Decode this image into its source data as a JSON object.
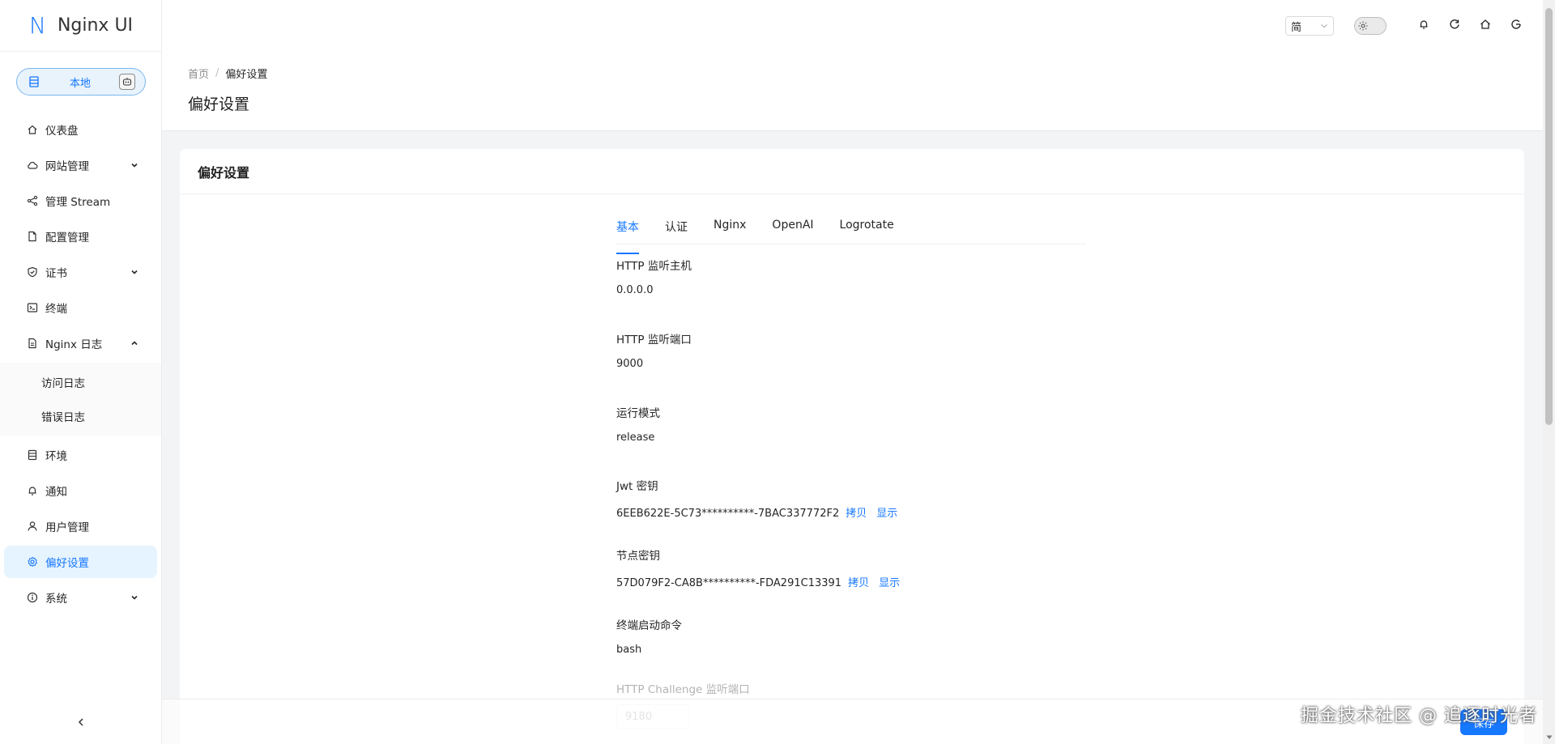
{
  "app": {
    "logo_mark": "N",
    "name": "Nginx UI"
  },
  "env": {
    "label": "本地"
  },
  "sidebar": {
    "items": [
      {
        "label": "仪表盘",
        "icon": "home-icon"
      },
      {
        "label": "网站管理",
        "icon": "cloud-icon",
        "arrow": "down"
      },
      {
        "label": "管理 Stream",
        "icon": "share-icon"
      },
      {
        "label": "配置管理",
        "icon": "file-icon"
      },
      {
        "label": "证书",
        "icon": "shield-icon",
        "arrow": "down"
      },
      {
        "label": "终端",
        "icon": "terminal-icon"
      },
      {
        "label": "Nginx 日志",
        "icon": "file-text-icon",
        "arrow": "up"
      },
      {
        "label": "访问日志"
      },
      {
        "label": "错误日志"
      },
      {
        "label": "环境",
        "icon": "database-icon"
      },
      {
        "label": "通知",
        "icon": "bell-icon"
      },
      {
        "label": "用户管理",
        "icon": "user-icon"
      },
      {
        "label": "偏好设置",
        "icon": "gear-icon",
        "active": true
      },
      {
        "label": "系统",
        "icon": "info-icon",
        "arrow": "down"
      }
    ]
  },
  "header": {
    "lang_value": "简"
  },
  "breadcrumb": {
    "home": "首页",
    "separator": "/",
    "current": "偏好设置"
  },
  "page_title": "偏好设置",
  "card_title": "偏好设置",
  "tabs": [
    "基本",
    "认证",
    "Nginx",
    "OpenAI",
    "Logrotate"
  ],
  "fields": [
    {
      "label": "HTTP 监听主机",
      "value": "0.0.0.0"
    },
    {
      "label": "HTTP 监听端口",
      "value": "9000"
    },
    {
      "label": "运行模式",
      "value": "release"
    },
    {
      "label": "Jwt 密钥",
      "value": "6EEB622E-5C73**********-7BAC337772F2",
      "copy": "拷贝",
      "show": "显示"
    },
    {
      "label": "节点密钥",
      "value": "57D079F2-CA8B**********-FDA291C13391",
      "copy": "拷贝",
      "show": "显示"
    },
    {
      "label": "终端启动命令",
      "value": "bash"
    },
    {
      "label": "HTTP Challenge 监听端口",
      "value": "9180"
    }
  ],
  "footer": {
    "save_label": "保存"
  },
  "watermark": "掘金技术社区 @ 追逐时光者",
  "colors": {
    "accent": "#1677ff",
    "active_bg": "#e6f4ff",
    "pill_bg": "#e8f3fc"
  }
}
